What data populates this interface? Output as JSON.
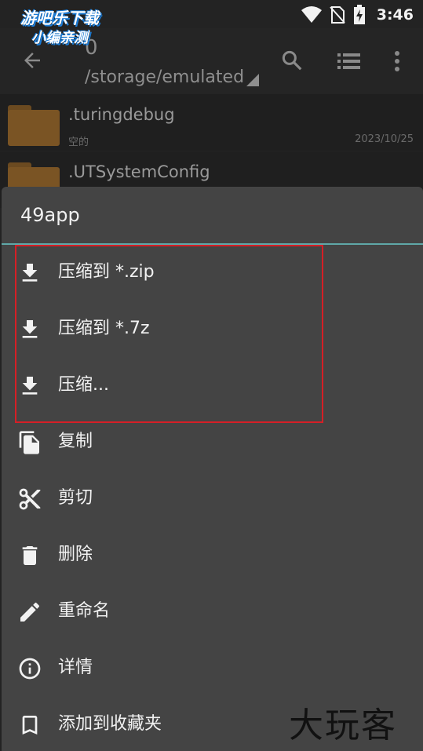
{
  "status_bar": {
    "time": "3:46",
    "icons": [
      "wifi-icon",
      "no-sim-icon",
      "battery-charging-icon"
    ]
  },
  "watermark_top": {
    "line1": "游吧乐下载",
    "line2": "小编亲测"
  },
  "toolbar": {
    "count": "0",
    "path": "/storage/emulated",
    "icons": [
      "back-arrow-icon",
      "search-icon",
      "list-view-icon",
      "more-vert-icon"
    ]
  },
  "files": [
    {
      "name": ".turingdebug",
      "sub": "空的",
      "date": "2023/10/25"
    },
    {
      "name": ".UTSystemConfig",
      "sub": "",
      "date": ""
    }
  ],
  "sheet": {
    "title": "49app",
    "items": [
      {
        "label": "压缩到 *.zip",
        "icon": "download-icon"
      },
      {
        "label": "压缩到 *.7z",
        "icon": "download-icon"
      },
      {
        "label": "压缩...",
        "icon": "download-icon"
      },
      {
        "label": "复制",
        "icon": "copy-icon"
      },
      {
        "label": "剪切",
        "icon": "scissors-icon"
      },
      {
        "label": "删除",
        "icon": "trash-icon"
      },
      {
        "label": "重命名",
        "icon": "pencil-icon"
      },
      {
        "label": "详情",
        "icon": "info-icon"
      },
      {
        "label": "添加到收藏夹",
        "icon": "bookmark-icon"
      }
    ]
  },
  "watermark_bottom": "大玩客",
  "colors": {
    "sheet_bg": "#444444",
    "accent_divider": "#5fa8a8",
    "highlight": "#d61f26",
    "folder": "#7a5424"
  }
}
